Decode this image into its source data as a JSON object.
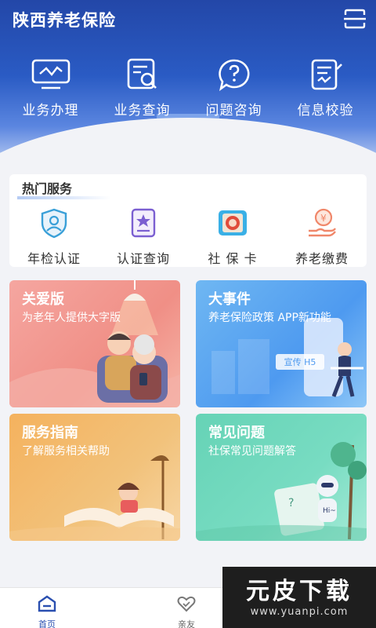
{
  "app": {
    "title": "陕西养老保险",
    "menu_icon": "scan-icon"
  },
  "quick_actions": [
    {
      "label": "业务办理",
      "icon": "monitor-chart-icon"
    },
    {
      "label": "业务查询",
      "icon": "document-search-icon"
    },
    {
      "label": "问题咨询",
      "icon": "question-bubble-icon"
    },
    {
      "label": "信息校验",
      "icon": "checklist-icon"
    }
  ],
  "hot_services": {
    "title": "热门服务",
    "items": [
      {
        "label": "年检认证",
        "icon": "face-shield-icon"
      },
      {
        "label": "认证查询",
        "icon": "star-card-icon"
      },
      {
        "label": "社 保 卡",
        "icon": "social-card-icon"
      },
      {
        "label": "养老缴费",
        "icon": "hand-coin-icon"
      }
    ]
  },
  "cards": [
    {
      "title": "关爱版",
      "subtitle": "为老年人提供大字版"
    },
    {
      "title": "大事件",
      "subtitle": "养老保险政策 APP新功能",
      "badge": "宣传 H5"
    },
    {
      "title": "服务指南",
      "subtitle": "了解服务相关帮助"
    },
    {
      "title": "常见问题",
      "subtitle": "社保常见问题解答"
    }
  ],
  "bottom_tabs": [
    {
      "label": "首页",
      "icon": "home-icon",
      "active": true
    },
    {
      "label": "亲友",
      "icon": "heart-icon",
      "active": false
    }
  ],
  "watermark": {
    "brand": "元皮下载",
    "url": "www.yuanpi.com"
  },
  "colors": {
    "header_blue": "#2347a8",
    "accent": "#2a4fb0"
  }
}
